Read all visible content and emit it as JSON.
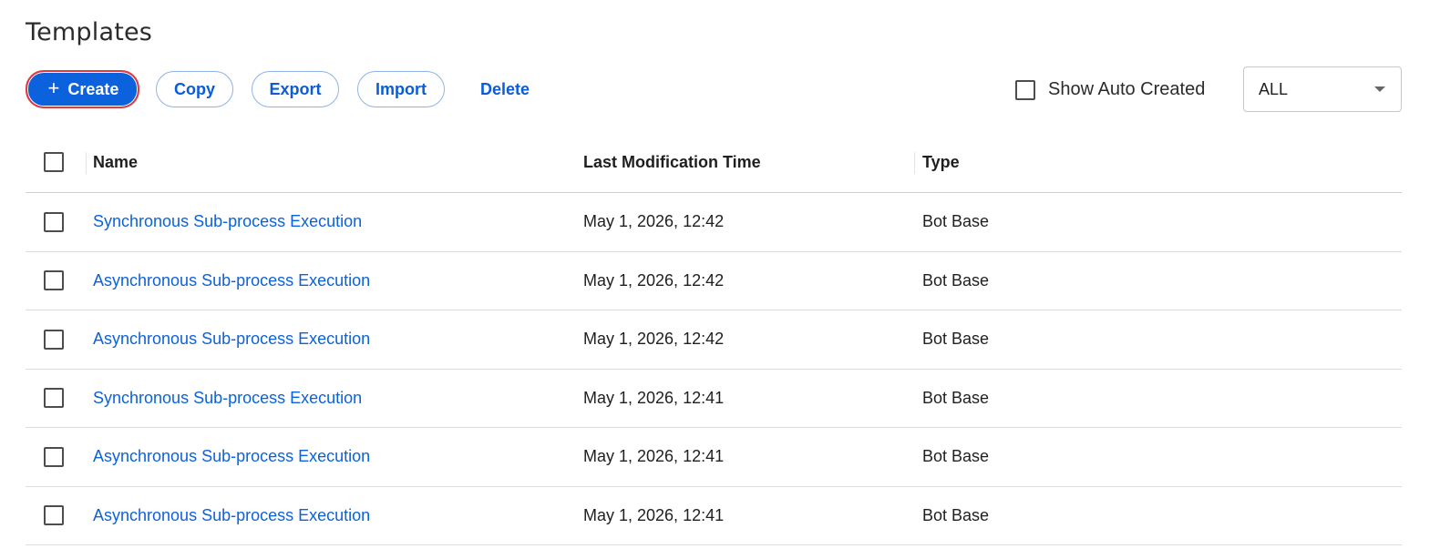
{
  "page": {
    "title": "Templates"
  },
  "toolbar": {
    "create_label": "Create",
    "create_icon": "+",
    "copy_label": "Copy",
    "export_label": "Export",
    "import_label": "Import",
    "delete_label": "Delete",
    "show_auto_created_label": "Show Auto Created",
    "filter_selected": "ALL"
  },
  "table": {
    "columns": {
      "name": "Name",
      "time": "Last Modification Time",
      "type": "Type"
    },
    "rows": [
      {
        "name": "Synchronous Sub-process Execution",
        "time": "May 1, 2026, 12:42",
        "type": "Bot Base"
      },
      {
        "name": "Asynchronous Sub-process Execution",
        "time": "May 1, 2026, 12:42",
        "type": "Bot Base"
      },
      {
        "name": "Asynchronous Sub-process Execution",
        "time": "May 1, 2026, 12:42",
        "type": "Bot Base"
      },
      {
        "name": "Synchronous Sub-process Execution",
        "time": "May 1, 2026, 12:41",
        "type": "Bot Base"
      },
      {
        "name": "Asynchronous Sub-process Execution",
        "time": "May 1, 2026, 12:41",
        "type": "Bot Base"
      },
      {
        "name": "Asynchronous Sub-process Execution",
        "time": "May 1, 2026, 12:41",
        "type": "Bot Base"
      }
    ]
  },
  "colors": {
    "primary": "#0b62dc",
    "focus_ring": "#e0393e",
    "link": "#0b62dc"
  }
}
